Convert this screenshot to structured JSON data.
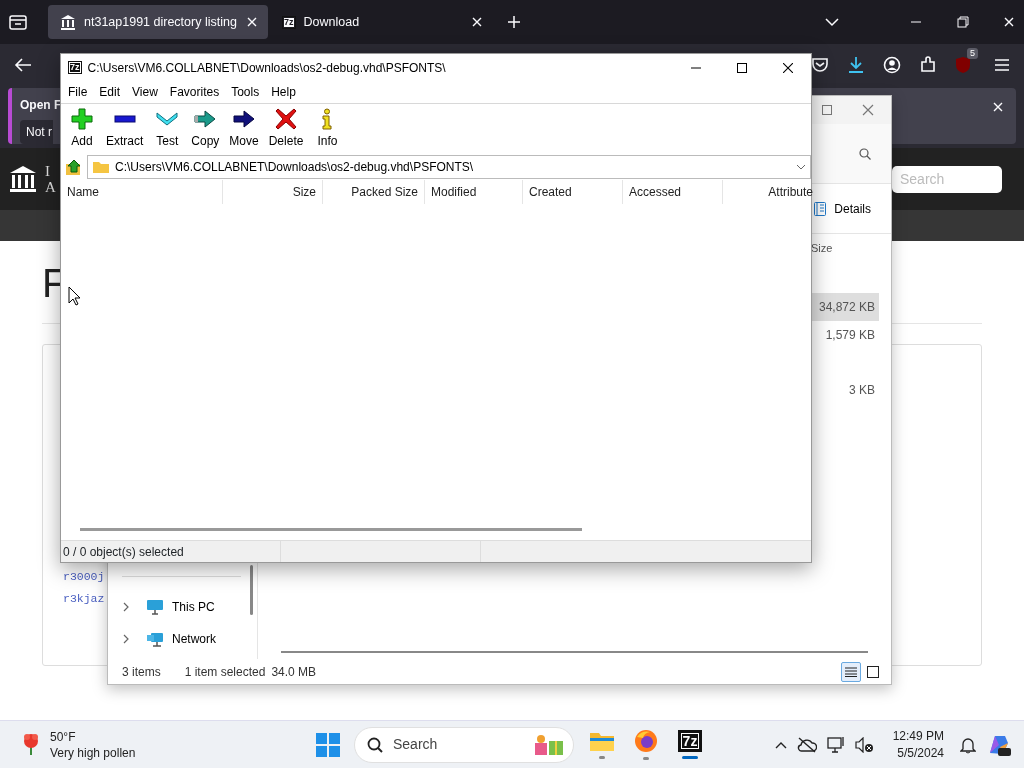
{
  "browser": {
    "tabs": [
      {
        "label": "nt31ap1991 directory listing",
        "selected": true
      },
      {
        "label": "Download",
        "logo": "7z",
        "selected": false
      }
    ],
    "extension_badge": "5",
    "notification": {
      "title": "Open F",
      "button": "Not r"
    },
    "site": {
      "logo_lines": [
        "I",
        "A"
      ],
      "search": {
        "placeholder": "Search"
      },
      "heading": "F",
      "links": [
        "r3000j",
        "r3kjaz"
      ]
    }
  },
  "explorer": {
    "view_button": "Details",
    "column": "Size",
    "rows": [
      {
        "size": "34,872 KB",
        "selected": true
      },
      {
        "size": "1,579 KB",
        "selected": false
      },
      {
        "size": "3 KB",
        "selected": false
      }
    ],
    "nav": [
      {
        "label": "This PC",
        "kind": "pc",
        "expanded": false
      },
      {
        "label": "Network",
        "kind": "network",
        "expanded": false
      }
    ],
    "status": {
      "count": "3 items",
      "selection": "1 item selected",
      "size": "34.0 MB"
    },
    "views": [
      {
        "kind": "details",
        "selected": true
      },
      {
        "kind": "tiles",
        "selected": false
      }
    ]
  },
  "archiver": {
    "logo": "7z",
    "title": "C:\\Users\\VM6.COLLABNET\\Downloads\\os2-debug.vhd\\PSFONTS\\",
    "menu": [
      "File",
      "Edit",
      "View",
      "Favorites",
      "Tools",
      "Help"
    ],
    "toolbar": [
      {
        "label": "Add",
        "kind": "add"
      },
      {
        "label": "Extract",
        "kind": "extract"
      },
      {
        "label": "Test",
        "kind": "test"
      },
      {
        "label": "Copy",
        "kind": "copy"
      },
      {
        "label": "Move",
        "kind": "move"
      },
      {
        "label": "Delete",
        "kind": "delete"
      },
      {
        "label": "Info",
        "kind": "info"
      }
    ],
    "address": "C:\\Users\\VM6.COLLABNET\\Downloads\\os2-debug.vhd\\PSFONTS\\",
    "columns": [
      "Name",
      "Size",
      "Packed Size",
      "Modified",
      "Created",
      "Accessed",
      "Attribute"
    ],
    "status": "0 / 0 object(s) selected"
  },
  "taskbar": {
    "weather": {
      "temperature": "50°F",
      "text": "Very high pollen"
    },
    "search": {
      "placeholder": "Search"
    },
    "apps": [
      {
        "kind": "explorer",
        "active": false
      },
      {
        "kind": "firefox",
        "active": false
      },
      {
        "kind": "archiver",
        "label": "7z",
        "active": true
      }
    ],
    "clock": {
      "time": "12:49 PM",
      "date": "5/5/2024"
    }
  }
}
